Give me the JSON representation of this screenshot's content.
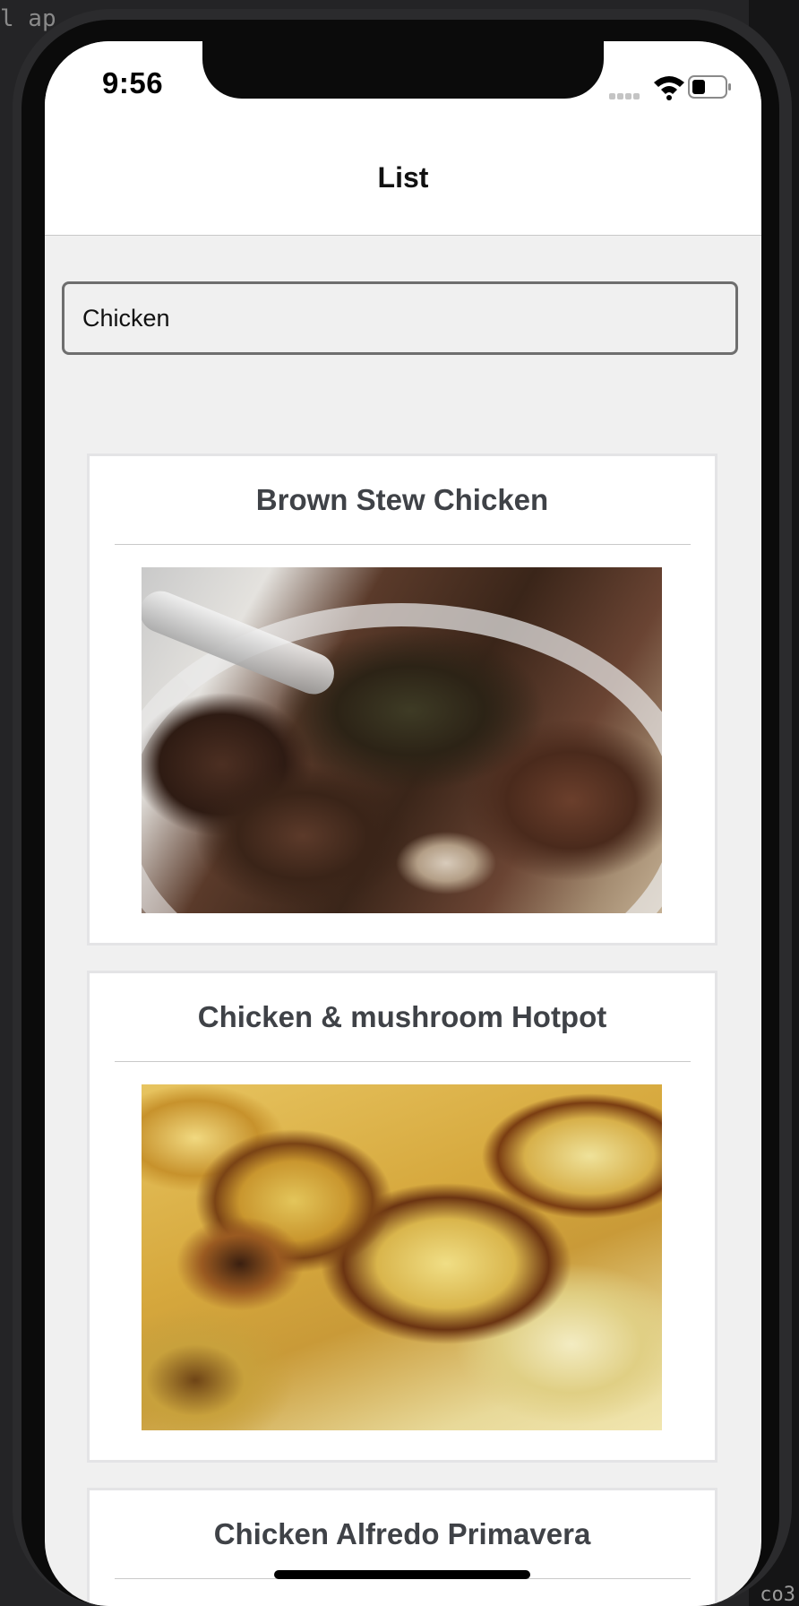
{
  "background_code": {
    "lines": [
      "l ap",
      "",
      "",
      "",
      "",
      "",
      "",
      "",
      "",
      "",
      "",
      ""
    ],
    "right_fragment": "co3"
  },
  "status_bar": {
    "time": "9:56"
  },
  "nav": {
    "title": "List"
  },
  "search": {
    "value": "Chicken"
  },
  "cards": [
    {
      "title": "Brown Stew Chicken",
      "image_icon": "stew-photo"
    },
    {
      "title": "Chicken & mushroom Hotpot",
      "image_icon": "hotpot-photo"
    },
    {
      "title": "Chicken Alfredo Primavera"
    }
  ]
}
